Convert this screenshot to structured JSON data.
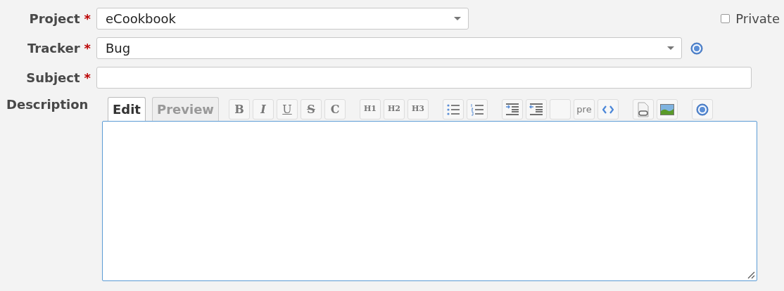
{
  "fields": [
    {
      "kind": "select",
      "label": "Project",
      "required": "*",
      "value": "eCookbook"
    },
    {
      "kind": "select",
      "label": "Tracker",
      "required": "*",
      "value": "Bug"
    },
    {
      "kind": "text",
      "label": "Subject",
      "required": "*"
    }
  ],
  "private": {
    "label": "Private",
    "checked": false
  },
  "description": {
    "label": "Description",
    "tabs": [
      {
        "label": "Edit",
        "selected": true
      },
      {
        "label": "Preview",
        "selected": false
      }
    ],
    "toolbar": [
      {
        "buttons": [
          {
            "kind": "bold",
            "label": "B"
          },
          {
            "kind": "italic",
            "label": "I"
          },
          {
            "kind": "underline",
            "label": "U"
          },
          {
            "kind": "strike",
            "label": "S"
          },
          {
            "kind": "bold",
            "label": "C"
          }
        ]
      },
      {
        "buttons": [
          {
            "kind": "heading",
            "label": "H1"
          },
          {
            "kind": "heading",
            "label": "H2"
          },
          {
            "kind": "heading",
            "label": "H3"
          }
        ]
      },
      {
        "buttons": [
          {
            "kind": "ul"
          },
          {
            "kind": "ol"
          }
        ]
      },
      {
        "buttons": [
          {
            "kind": "indent"
          },
          {
            "kind": "outdent"
          },
          {
            "kind": "blank"
          },
          {
            "kind": "plain",
            "label": "pre"
          },
          {
            "kind": "code"
          }
        ]
      },
      {
        "buttons": [
          {
            "kind": "link"
          },
          {
            "kind": "image"
          }
        ]
      },
      {
        "buttons": [
          {
            "kind": "help"
          }
        ]
      }
    ]
  }
}
